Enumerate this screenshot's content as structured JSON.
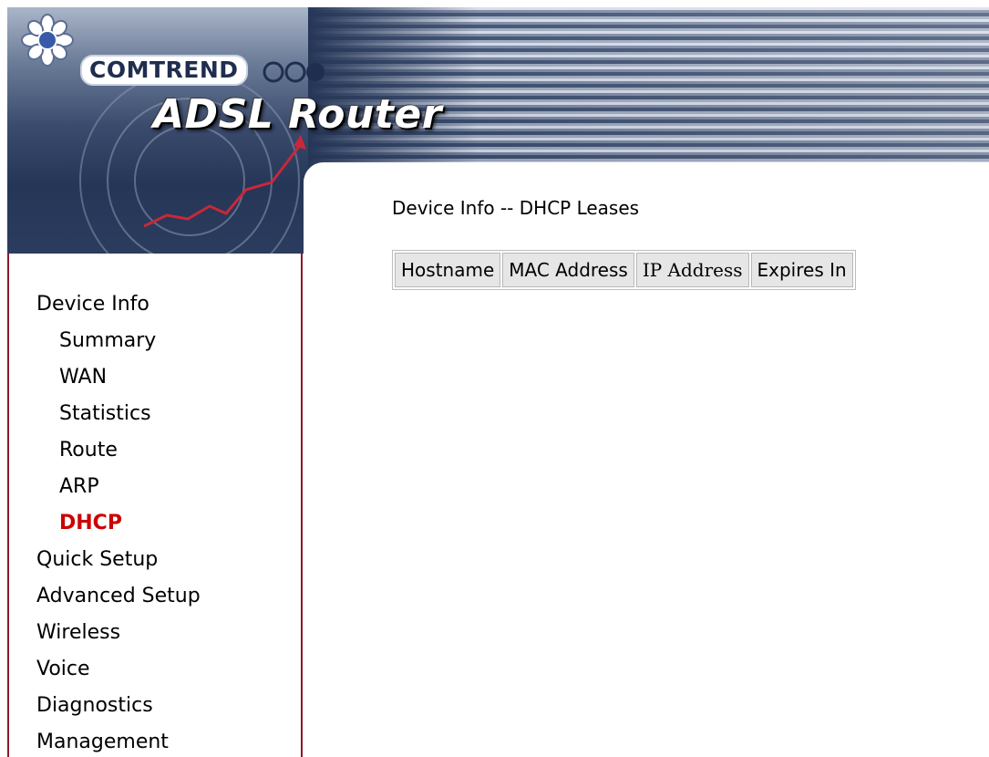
{
  "header": {
    "brand": "COMTREND",
    "product": "ADSL Router"
  },
  "icons": {
    "logo": "flower-logo-icon",
    "rings": "brand-rings-icon"
  },
  "colors": {
    "accent_active": "#cc0000",
    "sidebar_border": "#8b1a2a",
    "banner_dark": "#263657"
  },
  "sidebar": {
    "items": [
      {
        "label": "Device Info",
        "level": 0,
        "active": false
      },
      {
        "label": "Summary",
        "level": 1,
        "active": false
      },
      {
        "label": "WAN",
        "level": 1,
        "active": false
      },
      {
        "label": "Statistics",
        "level": 1,
        "active": false
      },
      {
        "label": "Route",
        "level": 1,
        "active": false
      },
      {
        "label": "ARP",
        "level": 1,
        "active": false
      },
      {
        "label": "DHCP",
        "level": 1,
        "active": true
      },
      {
        "label": "Quick Setup",
        "level": 0,
        "active": false
      },
      {
        "label": "Advanced Setup",
        "level": 0,
        "active": false
      },
      {
        "label": "Wireless",
        "level": 0,
        "active": false
      },
      {
        "label": "Voice",
        "level": 0,
        "active": false
      },
      {
        "label": "Diagnostics",
        "level": 0,
        "active": false
      },
      {
        "label": "Management",
        "level": 0,
        "active": false
      }
    ]
  },
  "main": {
    "title": "Device Info -- DHCP Leases",
    "table": {
      "columns": [
        "Hostname",
        "MAC Address",
        "IP Address",
        "Expires In"
      ],
      "rows": []
    }
  }
}
